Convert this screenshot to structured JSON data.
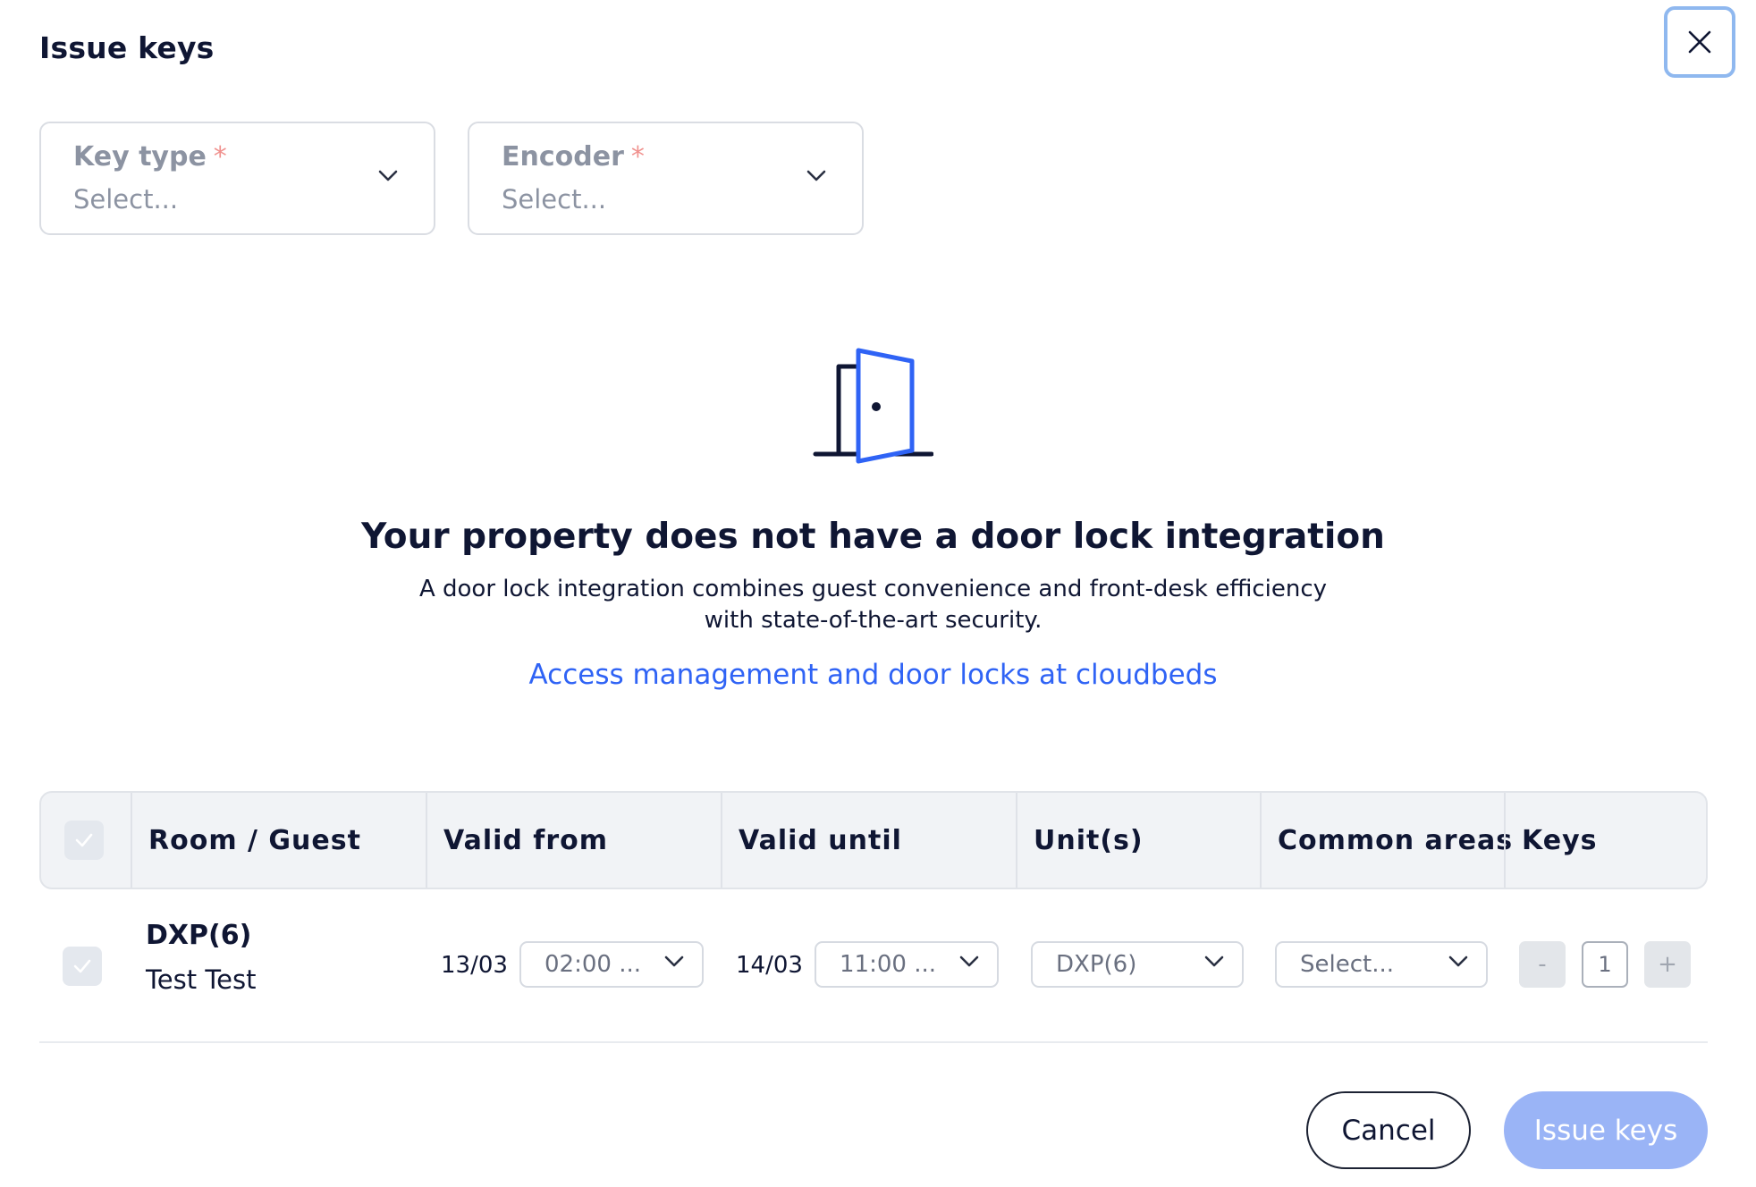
{
  "modal": {
    "title": "Issue keys"
  },
  "filters": {
    "key_type": {
      "label": "Key type",
      "required_mark": "*",
      "value": "Select..."
    },
    "encoder": {
      "label": "Encoder",
      "required_mark": "*",
      "value": "Select..."
    }
  },
  "empty_state": {
    "title": "Your property does not have a door lock integration",
    "description_line1": "A door lock integration combines guest convenience and front-desk efficiency",
    "description_line2": "with state-of-the-art security.",
    "link": "Access management and door locks at cloudbeds"
  },
  "table": {
    "headers": {
      "room_guest": "Room / Guest",
      "valid_from": "Valid from",
      "valid_until": "Valid until",
      "units": "Unit(s)",
      "common_areas": "Common areas",
      "keys": "Keys"
    },
    "rows": [
      {
        "room": "DXP(6)",
        "guest": "Test Test",
        "valid_from_date": "13/03",
        "valid_from_time": "02:00 ...",
        "valid_until_date": "14/03",
        "valid_until_time": "11:00 ...",
        "unit": "DXP(6)",
        "common_area": "Select...",
        "keys_decrement": "-",
        "keys_count": "1",
        "keys_increment": "+"
      }
    ]
  },
  "footer": {
    "cancel_label": "Cancel",
    "issue_label": "Issue keys"
  },
  "colors": {
    "accent": "#2f63f5",
    "primary_disabled": "#9ab4f6",
    "text": "#0f1633",
    "required": "#f0918e"
  }
}
